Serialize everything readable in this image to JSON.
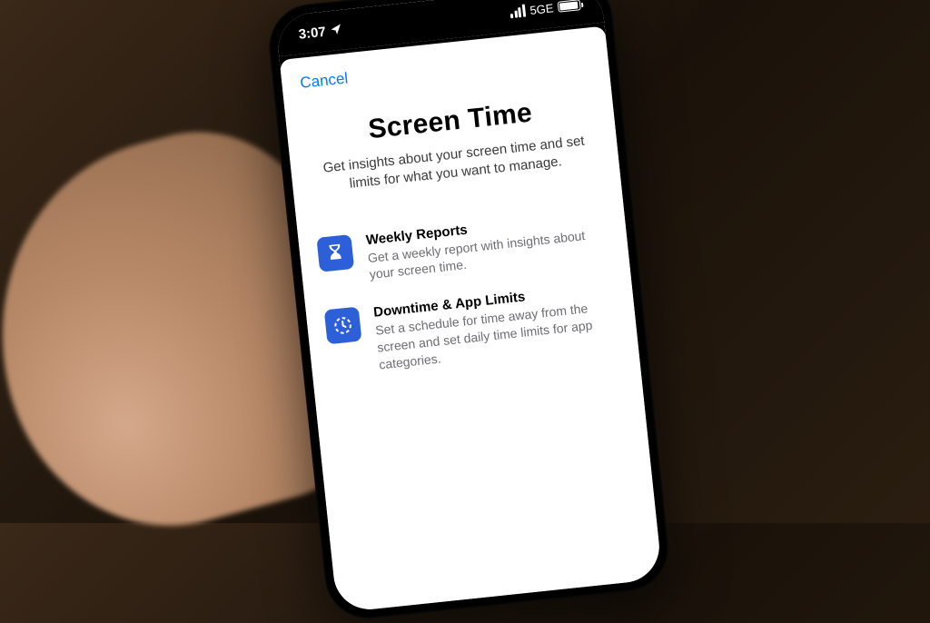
{
  "status": {
    "time": "3:07",
    "network": "5GE"
  },
  "modal": {
    "cancel": "Cancel",
    "title": "Screen Time",
    "subtitle": "Get insights about your screen time and set limits for what you want to manage."
  },
  "features": [
    {
      "title": "Weekly Reports",
      "desc": "Get a weekly report with insights about your screen time."
    },
    {
      "title": "Downtime & App Limits",
      "desc": "Set a schedule for time away from the screen and set daily time limits for app categories."
    }
  ]
}
